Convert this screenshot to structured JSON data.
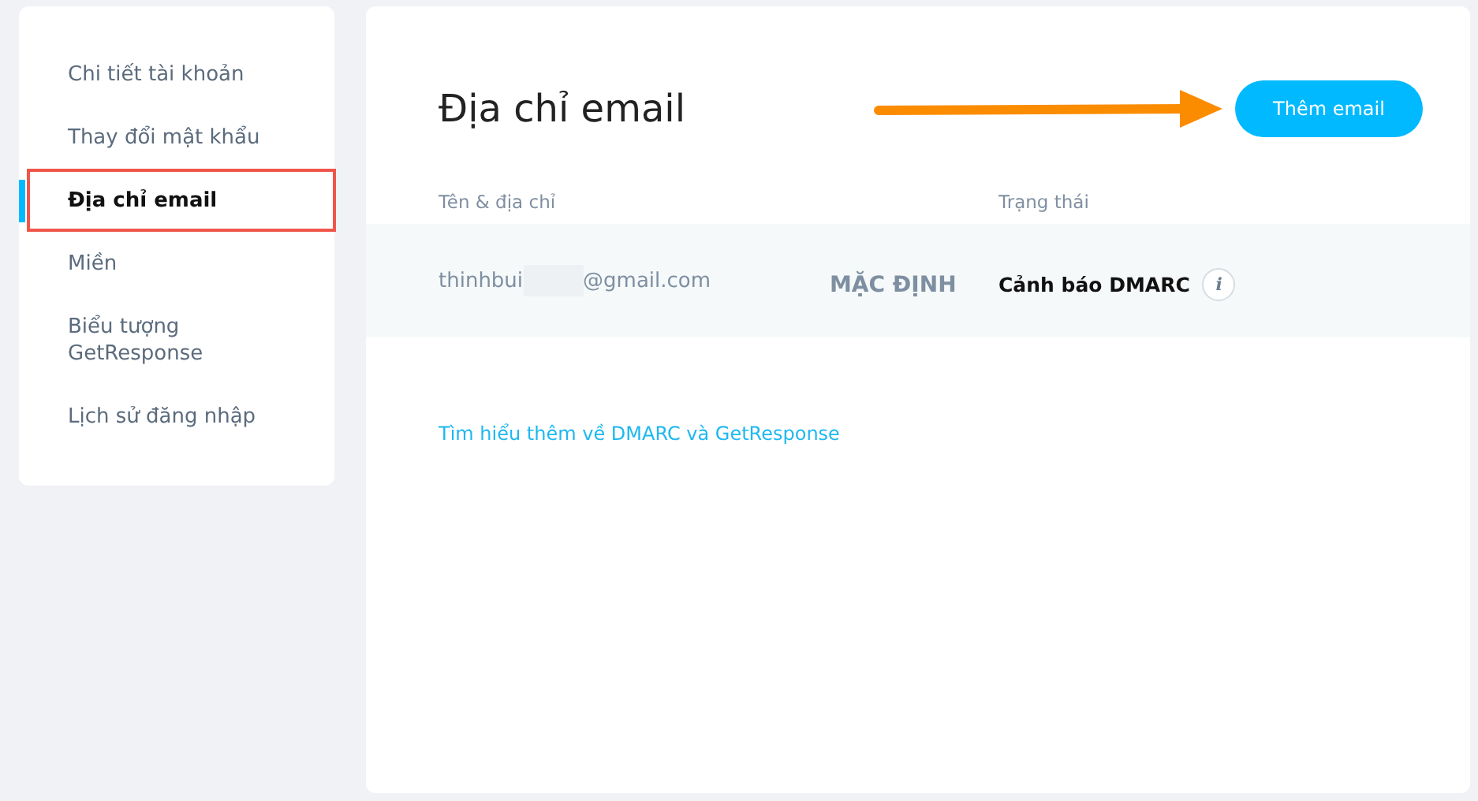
{
  "sidebar": {
    "items": [
      {
        "label": "Chi tiết tài khoản",
        "selected": false,
        "highlighted": false
      },
      {
        "label": "Thay đổi mật khẩu",
        "selected": false,
        "highlighted": false
      },
      {
        "label": "Địa chỉ email",
        "selected": true,
        "highlighted": true
      },
      {
        "label": "Miền",
        "selected": false,
        "highlighted": false
      },
      {
        "label": "Biểu tượng GetResponse",
        "selected": false,
        "highlighted": false
      },
      {
        "label": "Lịch sử đăng nhập",
        "selected": false,
        "highlighted": false
      }
    ]
  },
  "main": {
    "title": "Địa chỉ email",
    "add_button": {
      "label": "Thêm email",
      "pointed_by_arrow": true
    },
    "table": {
      "columns": [
        "Tên & địa chỉ",
        "Trạng thái"
      ],
      "rows": [
        {
          "email_start": "thinhbui",
          "email_redacted": true,
          "email_end": "@gmail.com",
          "badge": "MẶC ĐỊNH",
          "status": "Cảnh báo DMARC",
          "info": "i"
        }
      ]
    },
    "link": "Tìm hiểu thêm về DMARC và GetResponse"
  }
}
